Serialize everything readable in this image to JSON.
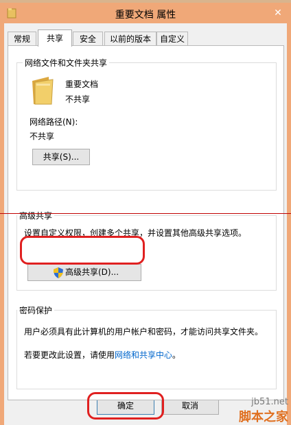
{
  "window": {
    "title": "重要文档 属性",
    "close_glyph": "✕"
  },
  "tabs": [
    {
      "label": "常规"
    },
    {
      "label": "共享",
      "active": true
    },
    {
      "label": "安全"
    },
    {
      "label": "以前的版本"
    },
    {
      "label": "自定义"
    }
  ],
  "network_sharing": {
    "group_title": "网络文件和文件夹共享",
    "folder_name": "重要文档",
    "folder_status": "不共享",
    "path_label": "网络路径(N):",
    "path_value": "不共享",
    "share_button": "共享(S)..."
  },
  "advanced_sharing": {
    "group_title": "高级共享",
    "description": "设置自定义权限，创建多个共享，并设置其他高级共享选项。",
    "button": "高级共享(D)..."
  },
  "password_protection": {
    "group_title": "密码保护",
    "description": "用户必须具有此计算机的用户帐户和密码，才能访问共享文件夹。",
    "change_prefix": "若要更改此设置，请使用",
    "link_text": "网络和共享中心",
    "change_suffix": "。"
  },
  "buttons": {
    "ok": "确定",
    "cancel": "取消"
  },
  "watermark": {
    "site": "jb51.net",
    "brand": "脚本之家"
  },
  "colors": {
    "titlebar": "#f0a878",
    "annotation": "#e02020",
    "link": "#0066cc",
    "folder": "#e8c060"
  },
  "icons": {
    "title": "folder-icon",
    "folder": "folder-icon",
    "shield": "uac-shield-icon"
  }
}
